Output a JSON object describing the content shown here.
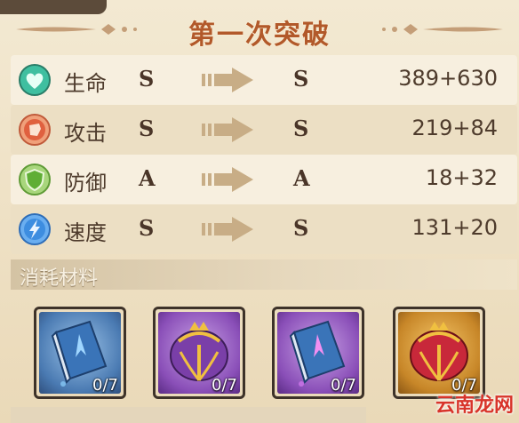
{
  "header": {
    "title": "第一次突破"
  },
  "stats": [
    {
      "label": "生命",
      "from": "S",
      "to": "S",
      "value": "389+630",
      "icon": "heart-icon",
      "color": "#3fbfa0"
    },
    {
      "label": "攻击",
      "from": "S",
      "to": "S",
      "value": "219+84",
      "icon": "fist-icon",
      "color": "#e0603f"
    },
    {
      "label": "防御",
      "from": "A",
      "to": "A",
      "value": "18+32",
      "icon": "shield-icon",
      "color": "#7ac04a"
    },
    {
      "label": "速度",
      "from": "S",
      "to": "S",
      "value": "131+20",
      "icon": "lightning-icon",
      "color": "#3d8de0"
    }
  ],
  "materials": {
    "title": "消耗材料",
    "items": [
      {
        "icon": "blue-book-icon",
        "count": "0/7"
      },
      {
        "icon": "purple-crown-icon",
        "count": "0/7"
      },
      {
        "icon": "purple-book-icon",
        "count": "0/7"
      },
      {
        "icon": "red-crown-icon",
        "count": "0/7"
      }
    ]
  },
  "watermark": "云南龙网",
  "colors": {
    "title": "#b2592a",
    "arrow": "#c8ad86",
    "text": "#4e3b2c"
  }
}
